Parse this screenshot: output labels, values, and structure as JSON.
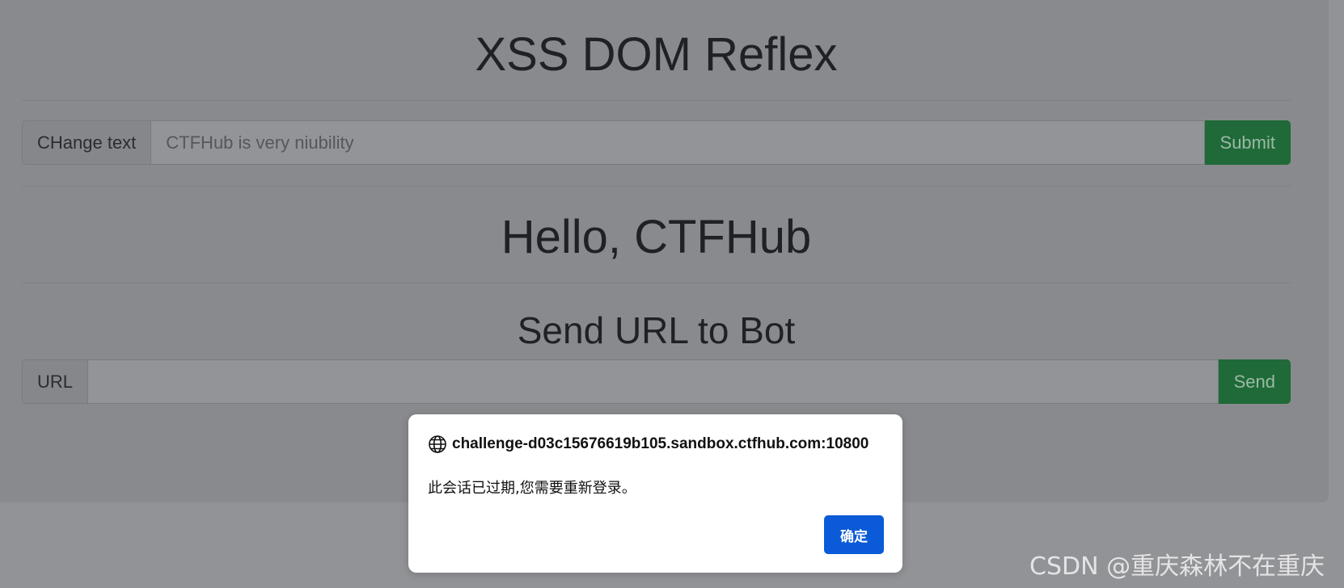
{
  "page": {
    "title": "XSS DOM Reflex",
    "change_text": {
      "label": "CHange text",
      "placeholder": "CTFHub is very niubility",
      "button": "Submit"
    },
    "greeting": "Hello, CTFHub",
    "bot": {
      "heading": "Send URL to Bot",
      "label": "URL",
      "value": "",
      "button": "Send"
    }
  },
  "dialog": {
    "origin": "challenge-d03c15676619b105.sandbox.ctfhub.com:10800",
    "message": "此会话已过期,您需要重新登录。",
    "ok_label": "确定",
    "icon": "globe-icon"
  },
  "watermark": "CSDN @重庆森林不在重庆",
  "colors": {
    "overlay_bg": "#898a8e",
    "button_green": "#1f6a38",
    "dialog_button": "#0b5ad8"
  }
}
